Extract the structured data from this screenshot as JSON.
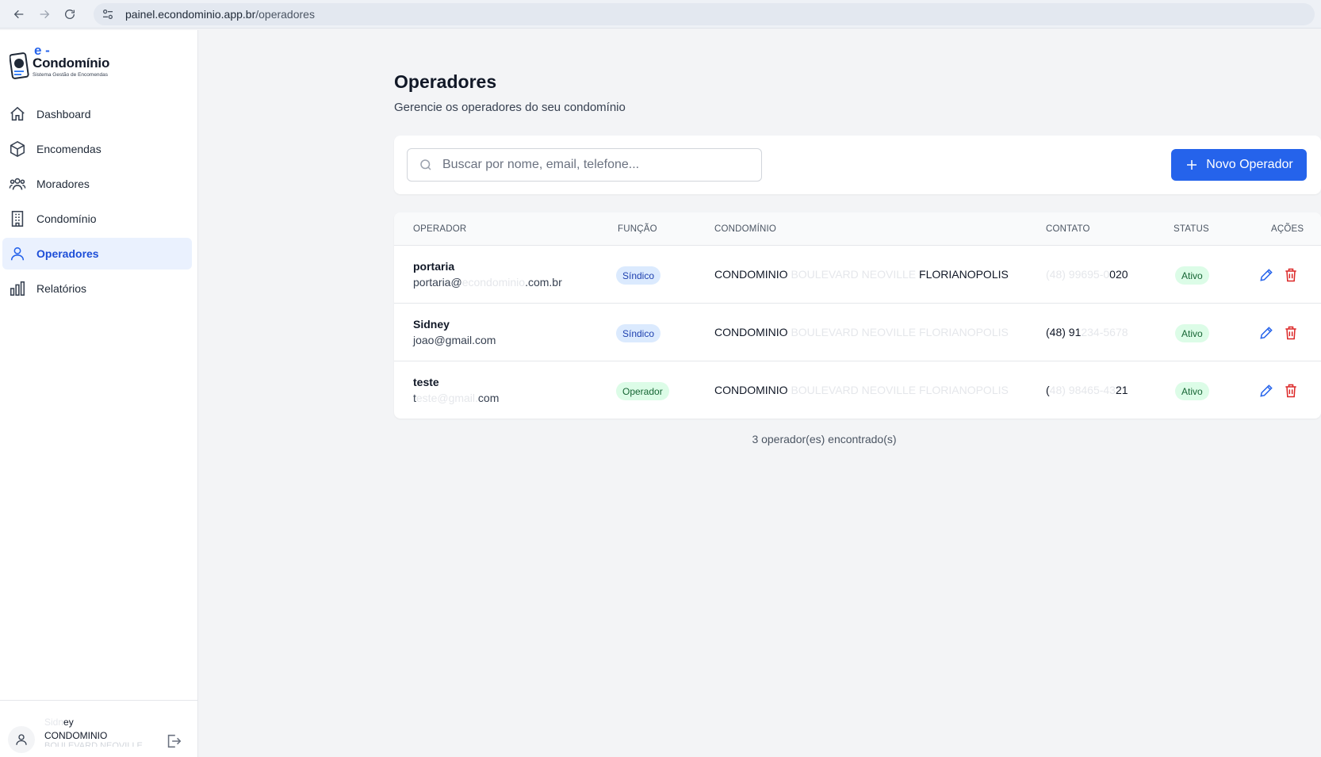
{
  "browser": {
    "url_host": "painel.econdominio.app.br",
    "url_path": "/operadores"
  },
  "brand": {
    "e": "e -",
    "name": "Condomínio",
    "tagline": "Sistema Gestão de Encomendas",
    "primary_color": "#2563eb"
  },
  "sidebar": {
    "items": [
      {
        "label": "Dashboard",
        "icon": "home-icon"
      },
      {
        "label": "Encomendas",
        "icon": "package-icon"
      },
      {
        "label": "Moradores",
        "icon": "users-icon"
      },
      {
        "label": "Condomínio",
        "icon": "building-icon"
      },
      {
        "label": "Operadores",
        "icon": "user-icon",
        "active": true
      },
      {
        "label": "Relatórios",
        "icon": "bar-chart-icon"
      }
    ],
    "user": {
      "name_faint": "Sidn",
      "name_visible": "ey",
      "condo": "CONDOMINIO",
      "condo_line2": "BOULEVARD NEOVILLE"
    }
  },
  "header": {
    "title": "Operadores",
    "subtitle": "Gerencie os operadores do seu condomínio"
  },
  "search": {
    "placeholder": "Buscar por nome, email, telefone...",
    "value": ""
  },
  "new_button": {
    "label": "Novo Operador"
  },
  "table": {
    "columns": [
      "OPERADOR",
      "FUNÇÃO",
      "CONDOMÍNIO",
      "CONTATO",
      "STATUS",
      "AÇÕES"
    ],
    "rows": [
      {
        "name": "portaria",
        "email_a": "portaria@",
        "email_b": "econdominio",
        "email_c": ".com.br",
        "role": "Síndico",
        "role_type": "sindico",
        "condo_a": "CONDOMINIO",
        "condo_b": " BOULEVARD NEOVILLE ",
        "condo_c": "FLORIANOPOLIS",
        "contact_a": "",
        "contact_b": "(48) 99695-0",
        "contact_c": "020",
        "status": "Ativo"
      },
      {
        "name": "Sidney",
        "email_a": "joao@gmail.com",
        "email_b": "",
        "email_c": "",
        "role": "Síndico",
        "role_type": "sindico",
        "condo_a": "CONDOMINIO",
        "condo_b": " BOULEVARD NEOVILLE FLORIANOPOLIS",
        "condo_c": "",
        "contact_a": "(48) 91",
        "contact_b": "234-5678",
        "contact_c": "",
        "status": "Ativo"
      },
      {
        "name": "teste",
        "email_a": "t",
        "email_b": "este@gmail.",
        "email_c": "com",
        "role": "Operador",
        "role_type": "operador",
        "condo_a": "CONDOMINIO",
        "condo_b": " BOULEVARD NEOVILLE FLORIANOPOLIS",
        "condo_c": "",
        "contact_a": "(",
        "contact_b": "48) 98465-43",
        "contact_c": "21",
        "status": "Ativo"
      }
    ]
  },
  "footer_count": "3 operador(es) encontrado(s)"
}
